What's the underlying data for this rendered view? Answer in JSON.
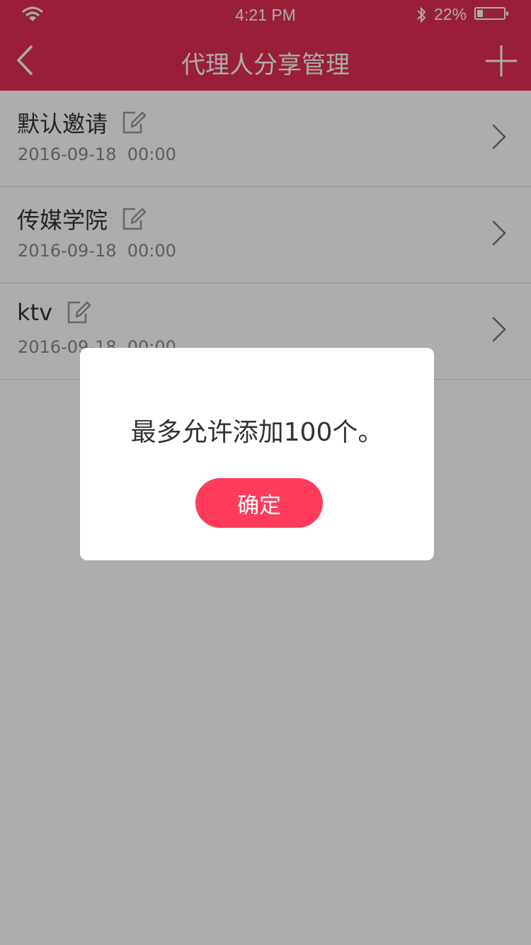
{
  "status_bar": {
    "time": "4:21 PM",
    "battery_percent": "22%",
    "battery_level": 0.22,
    "icons": [
      "wifi-icon",
      "bluetooth-icon",
      "battery-icon"
    ]
  },
  "nav": {
    "title": "代理人分享管理",
    "back_icon": "chevron-left-icon",
    "add_icon": "plus-icon"
  },
  "list": {
    "items": [
      {
        "name": "默认邀请",
        "date": "2016-09-18  00:00"
      },
      {
        "name": "传媒学院",
        "date": "2016-09-18  00:00"
      },
      {
        "name": "ktv",
        "date": "2016-09-18  00:00"
      }
    ]
  },
  "dialog": {
    "message": "最多允许添加100个。",
    "confirm_label": "确定"
  },
  "colors": {
    "brand": "#e02f51",
    "button": "#ff3b5c",
    "overlay": "rgba(0,0,0,0.32)"
  }
}
